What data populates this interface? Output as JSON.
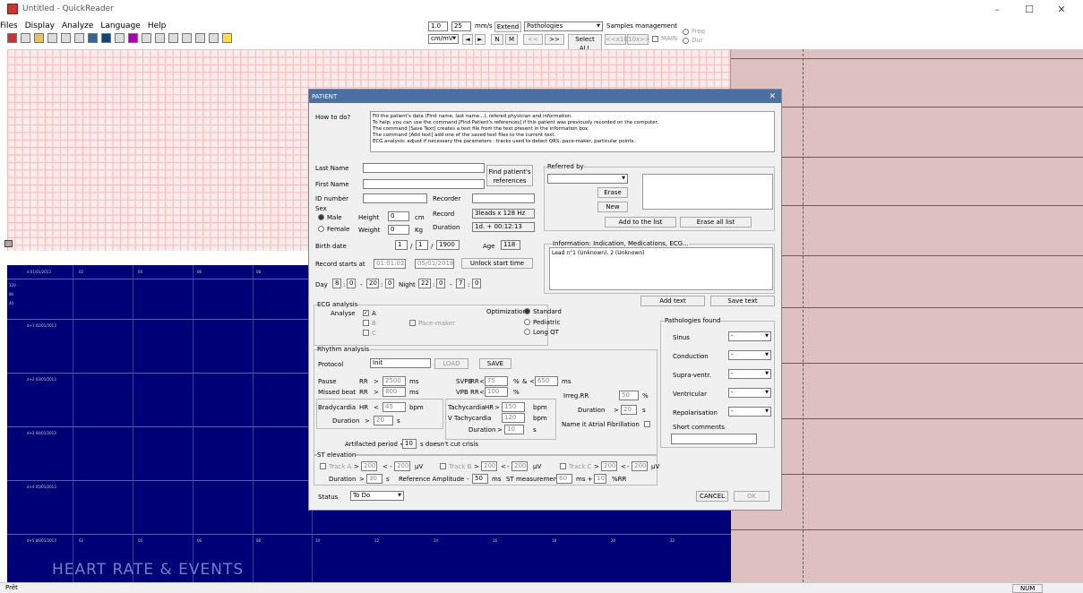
{
  "window": {
    "title": "Untitled - QuickReader",
    "minimize": "–",
    "maximize": "☐",
    "close": "✕"
  },
  "menu": [
    "Files",
    "Display",
    "Analyze",
    "Language",
    "Help"
  ],
  "ctrl": {
    "gain": "1.0",
    "speed": "25",
    "mms": "mm/s",
    "extend": "Extend",
    "pathologies": "Pathologies",
    "samples": "Samples management",
    "cmmv": "cm/mV",
    "prev": "◄",
    "next": "►",
    "n": "N",
    "m": "M",
    "back": "<<",
    "fwd": ">>",
    "selectall": "Select ALL",
    "x10b": "<<x10",
    "x10f": "10x>>",
    "main": "MAIN",
    "freq": "Freq",
    "dur": "Dur"
  },
  "hr": {
    "title": "HEART RATE & EVENTS",
    "days": [
      "d 01/01/2013",
      "d+1 02/01/2013",
      "d+2 03/01/2013",
      "d+3 04/01/2013",
      "d+4 05/01/2013",
      "d+5 06/01/2013"
    ],
    "cols": [
      "02",
      "04",
      "06",
      "08"
    ],
    "bottom_cols": [
      "10",
      "12",
      "14",
      "16",
      "18",
      "20",
      "22"
    ],
    "y": [
      "120",
      "80",
      "40"
    ]
  },
  "status": {
    "left": "Prêt",
    "num": "NUM"
  },
  "dlg": {
    "title": "PATIENT",
    "close": "✕",
    "howto_label": "How to do?",
    "howto": "Fill the patient's data (First name, last name...), refered physician and information.\nTo help, you can use the command [Find Patient's references] if this patient was previously recorded on the computer.\nThe command [Save Text] creates a text file from the text present in the information box.\nThe command [Add text] add one of the saved text files to the current text.\nECG analysis: adjust if necessary the parameters : tracks used to detect QRS, pace-maker, particular points.",
    "lastname": "Last Name",
    "firstname": "First Name",
    "id": "ID number",
    "recorder": "Recorder",
    "find": "Find patient's references",
    "sex": "Sex",
    "male": "Male",
    "female": "Female",
    "height": "Height",
    "height_val": "0",
    "cm": "cm",
    "weight": "Weight",
    "weight_val": "0",
    "kg": "Kg",
    "record": "Record",
    "record_val": "3leads x 128 Hz",
    "duration": "Duration",
    "duration_val": "1d. + 00:12:13",
    "birth": "Birth date",
    "bd": "1",
    "bm": "1",
    "by": "1900",
    "slash": "/",
    "age": "Age",
    "age_val": "118",
    "recstart": "Record starts at",
    "rs_time": "01:01:02",
    "rs_date": "05/01/2018",
    "unlock": "Unlock start time",
    "day": "Day",
    "d1": "8",
    "d2": "0",
    "d3": "20",
    "d4": "0",
    "night": "Night",
    "n1": "22",
    "n2": "0",
    "n3": "7",
    "n4": "0",
    "colon": ":",
    "dash": "-",
    "referred": "Referred by",
    "erase": "Erase",
    "new": "New",
    "add_list": "Add to the list",
    "erase_all": "Erase all list",
    "info_title": "Information: Indication, Medications, ECG...",
    "info_text": "Lead n°1 (Unknown), 2 (Unknown)",
    "add_text": "Add text",
    "save_text": "Save text",
    "ecg_title": "ECG analysis",
    "analyse": "Analyse",
    "a": "A",
    "b": "B",
    "c": "C",
    "check": "✓",
    "pace": "Pace-maker",
    "optim": "Optimization",
    "standard": "Standard",
    "pediatric": "Pediatric",
    "longqt": "Long QT",
    "rhythm": "Rhythm analysis",
    "protocol": "Protocol",
    "protocol_val": "Init",
    "load": "LOAD",
    "save": "SAVE",
    "pause": "Pause",
    "missed": "Missed beat",
    "rr": "RR",
    "gt": ">",
    "lt": "<",
    "pause_val": "2500",
    "missed_val": "800",
    "ms": "ms",
    "svpb": "SVPB",
    "svpb_val": "75",
    "pct": "%",
    "amp": "&",
    "svpb2": "650",
    "vpb": "VPB",
    "vpb_val": "100",
    "irreg": "Irreg.RR",
    "irreg_val": "50",
    "dur_lbl": "Duration",
    "irr_dur": "20",
    "s": "s",
    "brady": "Bradycardia",
    "hr": "HR",
    "brady_val": "45",
    "bpm": "bpm",
    "brady_dur": "20",
    "tachy": "Tachycardia",
    "tachy_val": "150",
    "vtachy": "V Tachycardia",
    "vtachy_val": "120",
    "vt_dur": "10",
    "af": "Name it Atrial Fibrillation",
    "artif": "Artifacted period <",
    "artif_val": "10",
    "artif_tail": "s  doesn't cut crisis",
    "st": "ST elevation",
    "tra": "Track A",
    "trb": "Track B",
    "trc": "Track C",
    "st_val": "200",
    "st_neg": "200",
    "uv": "µV",
    "st_dur": "30",
    "ref": "Reference Amplitude",
    "ref_val": "50",
    "stm": "ST measurement",
    "stm_val": "60",
    "stm_plus": "10",
    "rr_pct": "%RR",
    "ms_plus": "ms +",
    "status": "Status",
    "status_val": "To Do",
    "cancel": "CANCEL",
    "ok": "OK",
    "path": "Pathologies found",
    "p": [
      "Sinus",
      "Conduction",
      "Supra-ventr.",
      "Ventricular",
      "Repolarisation"
    ],
    "p_val": "-",
    "short": "Short comments"
  }
}
